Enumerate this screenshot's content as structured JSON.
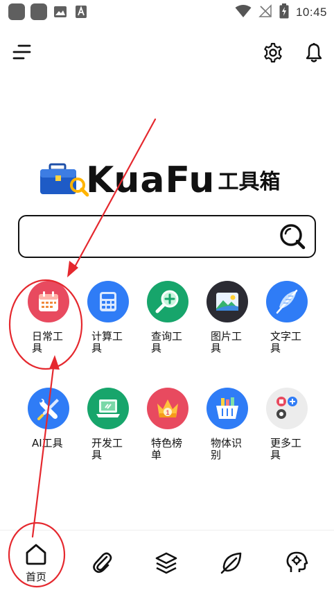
{
  "status_bar": {
    "time": "10:45",
    "left_icons": [
      "app-icon",
      "app-icon",
      "image-icon",
      "font-icon"
    ],
    "right_icons": [
      "wifi-icon",
      "no-signal-icon",
      "battery-charging-icon"
    ]
  },
  "header": {
    "menu_icon": "menu-icon",
    "settings_icon": "gear-icon",
    "notification_icon": "bell-icon"
  },
  "logo": {
    "brand": "KuaFu",
    "suffix": "工具箱"
  },
  "search": {
    "placeholder": "",
    "value": "",
    "icon": "search-icon"
  },
  "tools": [
    {
      "label": "日常工具",
      "icon": "calendar-icon",
      "color": "#e84a5f"
    },
    {
      "label": "计算工具",
      "icon": "calculator-icon",
      "color": "#2f7cf6"
    },
    {
      "label": "查询工具",
      "icon": "magnifier-plus-icon",
      "color": "#17a56b"
    },
    {
      "label": "图片工具",
      "icon": "picture-icon",
      "color": "#2b2b33"
    },
    {
      "label": "文字工具",
      "icon": "feather-icon",
      "color": "#2f7cf6"
    },
    {
      "label": "AI工具",
      "icon": "wrench-screwdriver-icon",
      "color": "#2f7cf6"
    },
    {
      "label": "开发工具",
      "icon": "laptop-icon",
      "color": "#17a56b"
    },
    {
      "label": "特色榜单",
      "icon": "crown-icon",
      "color": "#e84a5f"
    },
    {
      "label": "物体识别",
      "icon": "basket-icon",
      "color": "#2f7cf6"
    },
    {
      "label": "更多工具",
      "icon": "more-apps-icon",
      "color": "#ececec"
    }
  ],
  "bottom_nav": [
    {
      "label": "首页",
      "icon": "home-icon"
    },
    {
      "label": "",
      "icon": "paperclip-icon"
    },
    {
      "label": "",
      "icon": "layers-icon"
    },
    {
      "label": "",
      "icon": "leaf-icon"
    },
    {
      "label": "",
      "icon": "brain-gear-icon"
    }
  ],
  "annotation_color": "#e5282e"
}
